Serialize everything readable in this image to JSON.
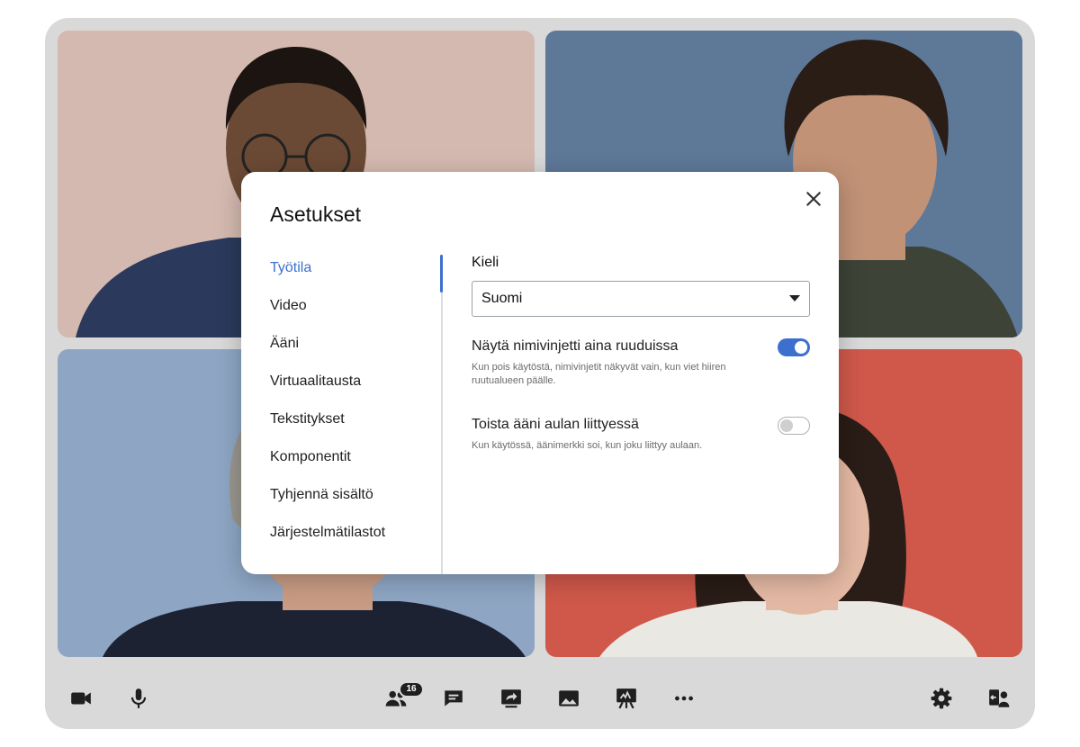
{
  "participants": [
    {
      "background": "#d4b9b0",
      "skin": "#6b4a35",
      "hair": "#1b1410",
      "shirt": "#2b3a5c"
    },
    {
      "background": "#5e7898",
      "skin": "#c29277",
      "hair": "#2a1d15",
      "shirt": "#3d4337"
    },
    {
      "background": "#8ea6c4",
      "skin": "#c89c84",
      "hair": "#9a9790",
      "shirt": "#1d2233"
    },
    {
      "background": "#cf584a",
      "skin": "#e4b9a4",
      "hair": "#2a1c16",
      "shirt": "#eae8e2"
    }
  ],
  "toolbar": {
    "camera_icon": "camera-icon",
    "mic_icon": "microphone-icon",
    "participants_icon": "people-icon",
    "participants_count": "16",
    "chat_icon": "chat-icon",
    "share_icon": "screen-share-icon",
    "media_icon": "image-icon",
    "whiteboard_icon": "whiteboard-icon",
    "more_icon": "more-horizontal-icon",
    "settings_icon": "gear-icon",
    "profile_icon": "person-settings-icon"
  },
  "dialog": {
    "title": "Asetukset",
    "close_icon": "close-icon",
    "nav": [
      {
        "label": "Työtila",
        "active": true
      },
      {
        "label": "Video",
        "active": false
      },
      {
        "label": "Ääni",
        "active": false
      },
      {
        "label": "Virtuaalitausta",
        "active": false
      },
      {
        "label": "Tekstitykset",
        "active": false
      },
      {
        "label": "Komponentit",
        "active": false
      },
      {
        "label": "Tyhjennä sisältö",
        "active": false
      },
      {
        "label": "Järjestelmätilastot",
        "active": false
      }
    ],
    "language": {
      "label": "Kieli",
      "value": "Suomi"
    },
    "settings": [
      {
        "title": "Näytä nimivinjetti aina ruuduissa",
        "description": "Kun pois käytöstä, nimivinjetit näkyvät vain, kun viet hiiren ruutualueen päälle.",
        "enabled": true
      },
      {
        "title": "Toista ääni aulan liittyessä",
        "description": "Kun käytössä, äänimerkki soi, kun joku liittyy aulaan.",
        "enabled": false
      }
    ],
    "accent_color": "#3c6fce"
  }
}
